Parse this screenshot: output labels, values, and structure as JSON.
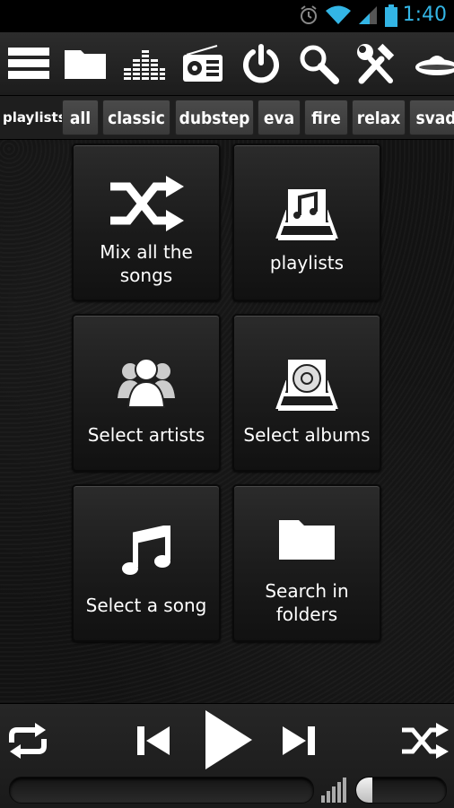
{
  "status_bar": {
    "time": "1:40"
  },
  "toolbar": {
    "buttons": [
      "list-menu-icon",
      "folder-icon",
      "equalizer-icon",
      "radio-icon",
      "power-icon",
      "search-icon",
      "tools-icon",
      "ufo-icon"
    ]
  },
  "playlists": {
    "label": "playlists:",
    "chips": [
      "all",
      "classic",
      "dubstep",
      "eva",
      "fire",
      "relax",
      "svad"
    ]
  },
  "tiles": [
    {
      "label": "Mix all the\nsongs",
      "icon": "shuffle-icon"
    },
    {
      "label": "playlists",
      "icon": "playlist-box-icon"
    },
    {
      "label": "Select artists",
      "icon": "artists-icon"
    },
    {
      "label": "Select albums",
      "icon": "album-box-icon"
    },
    {
      "label": "Select a song",
      "icon": "music-note-icon"
    },
    {
      "label": "Search in\nfolders",
      "icon": "folder-icon"
    }
  ],
  "player": {
    "progress": 0,
    "volume": 0.1
  },
  "colors": {
    "accent": "#33b5e5",
    "background": "#151515",
    "tile": "#222222"
  }
}
